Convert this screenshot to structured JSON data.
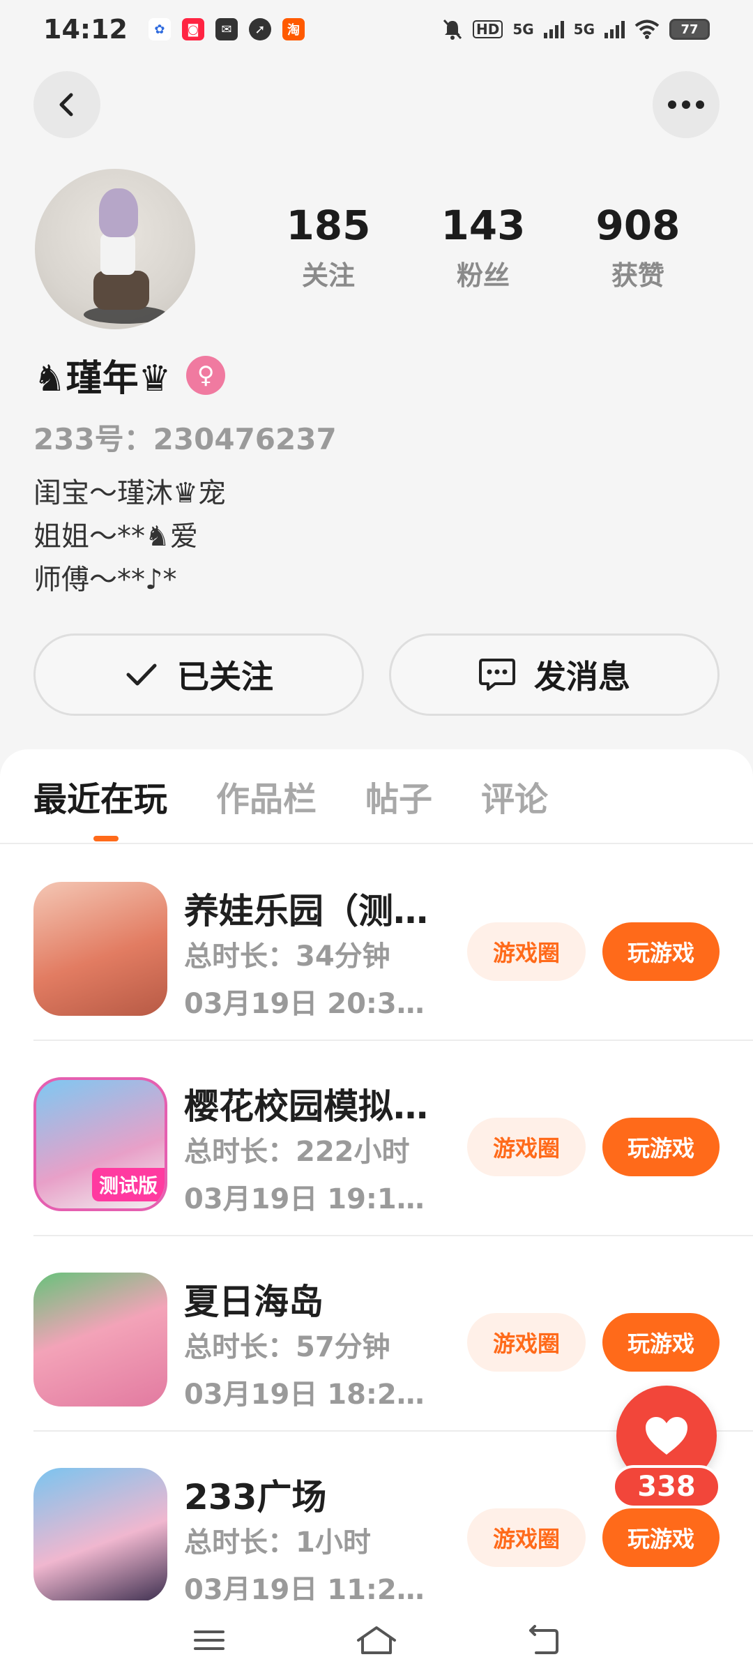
{
  "status_bar": {
    "time": "14:12",
    "signal_1": "5G",
    "signal_2": "5G",
    "battery": "77",
    "app_icons": [
      "baidu-icon",
      "xiaohongshu-icon",
      "mail-icon",
      "compass-icon",
      "taobao-icon"
    ]
  },
  "profile": {
    "name": "♞瑾年♛",
    "gender_symbol": "♀",
    "uid_text": "233号：230476237",
    "bio": [
      "闺宝～瑾沐♛宠",
      "姐姐～**♞爱",
      "师傅～**♪*"
    ],
    "stats": [
      {
        "value": "185",
        "label": "关注"
      },
      {
        "value": "143",
        "label": "粉丝"
      },
      {
        "value": "908",
        "label": "获赞"
      }
    ]
  },
  "actions": {
    "follow_label": "已关注",
    "message_label": "发消息"
  },
  "tabs": [
    {
      "label": "最近在玩",
      "active": true
    },
    {
      "label": "作品栏",
      "active": false
    },
    {
      "label": "帖子",
      "active": false
    },
    {
      "label": "评论",
      "active": false
    }
  ],
  "games": [
    {
      "title": "养娃乐园（测…",
      "duration": "总时长：34分钟",
      "last_played": "03月19日 20:3…",
      "circle_label": "游戏圈",
      "play_label": "玩游戏"
    },
    {
      "title": "樱花校园模拟…",
      "duration": "总时长：222小时",
      "last_played": "03月19日 19:1…",
      "circle_label": "游戏圈",
      "play_label": "玩游戏",
      "badge": "测试版"
    },
    {
      "title": "夏日海岛",
      "duration": "总时长：57分钟",
      "last_played": "03月19日 18:2…",
      "circle_label": "游戏圈",
      "play_label": "玩游戏"
    },
    {
      "title": "233广场",
      "duration": "总时长：1小时",
      "last_played": "03月19日 11:2…",
      "circle_label": "游戏圈",
      "play_label": "玩游戏"
    }
  ],
  "like": {
    "count": "338"
  },
  "colors": {
    "accent": "#ff6a1a",
    "like_red": "#f2463a",
    "gender_pink": "#f07aa0"
  }
}
